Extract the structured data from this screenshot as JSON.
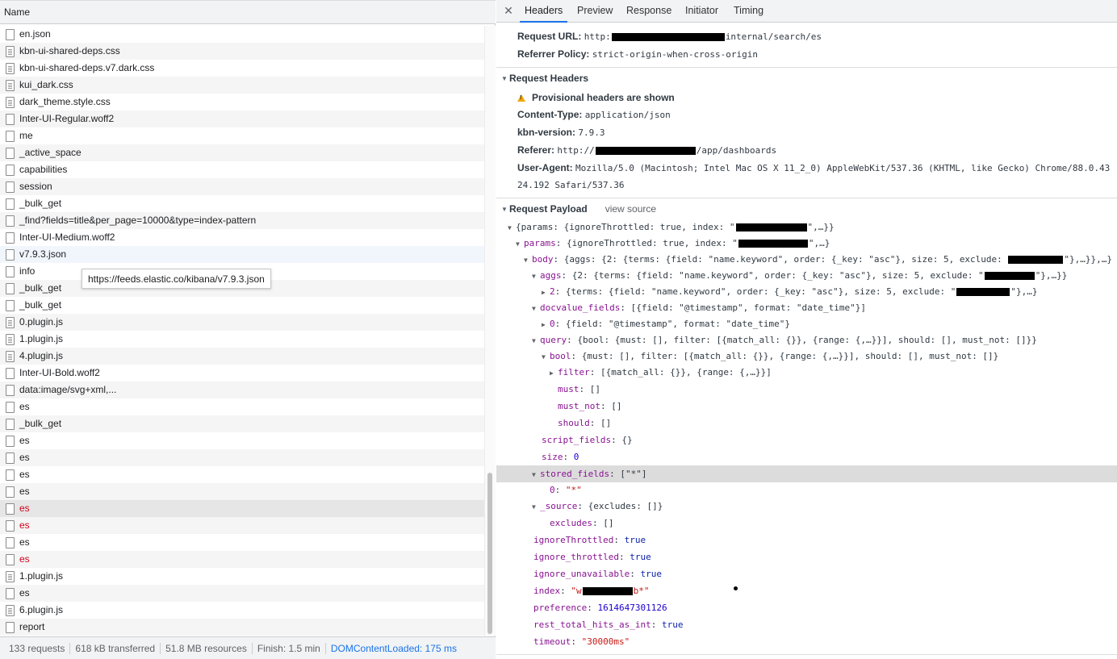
{
  "list": {
    "header": "Name",
    "rows": [
      {
        "name": "en.json",
        "icon": "document-icon",
        "error": false
      },
      {
        "name": "kbn-ui-shared-deps.css",
        "icon": "stylesheet-icon",
        "error": false
      },
      {
        "name": "kbn-ui-shared-deps.v7.dark.css",
        "icon": "stylesheet-icon",
        "error": false
      },
      {
        "name": "kui_dark.css",
        "icon": "stylesheet-icon",
        "error": false
      },
      {
        "name": "dark_theme.style.css",
        "icon": "stylesheet-icon",
        "error": false
      },
      {
        "name": "Inter-UI-Regular.woff2",
        "icon": "document-icon",
        "error": false
      },
      {
        "name": "me",
        "icon": "document-icon",
        "error": false
      },
      {
        "name": "_active_space",
        "icon": "document-icon",
        "error": false
      },
      {
        "name": "capabilities",
        "icon": "document-icon",
        "error": false
      },
      {
        "name": "session",
        "icon": "document-icon",
        "error": false
      },
      {
        "name": "_bulk_get",
        "icon": "document-icon",
        "error": false
      },
      {
        "name": "_find?fields=title&per_page=10000&type=index-pattern",
        "icon": "document-icon",
        "error": false
      },
      {
        "name": "Inter-UI-Medium.woff2",
        "icon": "document-icon",
        "error": false
      },
      {
        "name": "v7.9.3.json",
        "icon": "document-icon",
        "error": false,
        "hover": true
      },
      {
        "name": "info",
        "icon": "document-icon",
        "error": false
      },
      {
        "name": "_bulk_get",
        "icon": "document-icon",
        "error": false
      },
      {
        "name": "_bulk_get",
        "icon": "document-icon",
        "error": false
      },
      {
        "name": "0.plugin.js",
        "icon": "script-icon",
        "error": false
      },
      {
        "name": "1.plugin.js",
        "icon": "script-icon",
        "error": false
      },
      {
        "name": "4.plugin.js",
        "icon": "script-icon",
        "error": false
      },
      {
        "name": "Inter-UI-Bold.woff2",
        "icon": "document-icon",
        "error": false
      },
      {
        "name": "data:image/svg+xml,...",
        "icon": "document-icon",
        "error": false
      },
      {
        "name": "es",
        "icon": "document-icon",
        "error": false
      },
      {
        "name": "_bulk_get",
        "icon": "document-icon",
        "error": false
      },
      {
        "name": "es",
        "icon": "document-icon",
        "error": false
      },
      {
        "name": "es",
        "icon": "document-icon",
        "error": false
      },
      {
        "name": "es",
        "icon": "document-icon",
        "error": false
      },
      {
        "name": "es",
        "icon": "document-icon",
        "error": false
      },
      {
        "name": "es",
        "icon": "document-icon",
        "error": true,
        "selected": true
      },
      {
        "name": "es",
        "icon": "document-icon",
        "error": true
      },
      {
        "name": "es",
        "icon": "document-icon",
        "error": false
      },
      {
        "name": "es",
        "icon": "document-icon",
        "error": true
      },
      {
        "name": "1.plugin.js",
        "icon": "script-icon",
        "error": false
      },
      {
        "name": "es",
        "icon": "document-icon",
        "error": false
      },
      {
        "name": "6.plugin.js",
        "icon": "script-icon",
        "error": false
      },
      {
        "name": "report",
        "icon": "document-icon",
        "error": false
      }
    ],
    "tooltip": "https://feeds.elastic.co/kibana/v7.9.3.json"
  },
  "status": {
    "requests": "133 requests",
    "transferred": "618 kB transferred",
    "resources": "51.8 MB resources",
    "finish": "Finish: 1.5 min",
    "dom_loaded": "DOMContentLoaded: 175 ms"
  },
  "tabs": [
    "Headers",
    "Preview",
    "Response",
    "Initiator",
    "Timing"
  ],
  "general": {
    "url_key": "Request URL:",
    "url_prefix": "http:",
    "url_suffix": "internal/search/es",
    "policy_key": "Referrer Policy:",
    "policy_value": "strict-origin-when-cross-origin"
  },
  "request_headers": {
    "title": "Request Headers",
    "warning": "Provisional headers are shown",
    "content_type_key": "Content-Type:",
    "content_type_value": "application/json",
    "kbn_key": "kbn-version:",
    "kbn_value": "7.9.3",
    "referer_key": "Referer:",
    "referer_prefix": "http://",
    "referer_suffix": "/app/dashboards",
    "ua_key": "User-Agent:",
    "ua_value_1": "Mozilla/5.0 (Macintosh; Intel Mac OS X 11_2_0) AppleWebKit/537.36 (KHTML, like Gecko) Chrome/88.0.43",
    "ua_value_2": "24.192 Safari/537.36"
  },
  "payload": {
    "title": "Request Payload",
    "view_source": "view source",
    "l1_a": "{params: {ignoreThrottled: true, index: \"",
    "l1_b": "\",…}}",
    "l2_key": "params",
    "l2_a": ": {ignoreThrottled: true, index: \"",
    "l2_b": "\",…}",
    "l3_key": "body",
    "l3_a": ": {aggs: {2: {terms: {field: \"name.keyword\", order: {_key: \"asc\"}, size: 5, exclude: ",
    "l3_b": "\"},…}},…}",
    "l4_key": "aggs",
    "l4_a": ": {2: {terms: {field: \"name.keyword\", order: {_key: \"asc\"}, size: 5, exclude: \"",
    "l4_b": "\"},…}}",
    "l5_key": "2",
    "l5_a": ": {terms: {field: \"name.keyword\", order: {_key: \"asc\"}, size: 5, exclude: \"",
    "l5_b": "\"},…}",
    "l6_key": "docvalue_fields",
    "l6_val": ": [{field: \"@timestamp\", format: \"date_time\"}]",
    "l7_key": "0",
    "l7_val": ": {field: \"@timestamp\", format: \"date_time\"}",
    "l8_key": "query",
    "l8_val": ": {bool: {must: [], filter: [{match_all: {}}, {range: {,…}}], should: [], must_not: []}}",
    "l9_key": "bool",
    "l9_val": ": {must: [], filter: [{match_all: {}}, {range: {,…}}], should: [], must_not: []}",
    "l10_key": "filter",
    "l10_val": ": [{match_all: {}}, {range: {,…}}]",
    "l11_key": "must",
    "l11_val": ": []",
    "l12_key": "must_not",
    "l12_val": ": []",
    "l13_key": "should",
    "l13_val": ": []",
    "l14_key": "script_fields",
    "l14_val": ": {}",
    "l15_key": "size",
    "l15_val": "0",
    "l16_key": "stored_fields",
    "l16_val": ": [\"*\"]",
    "l17_key": "0",
    "l17_val": "\"*\"",
    "l18_key": "_source",
    "l18_val": ": {excludes: []}",
    "l19_key": "excludes",
    "l19_val": ": []",
    "l20_key": "ignoreThrottled",
    "l20_val": "true",
    "l21_key": "ignore_throttled",
    "l21_val": "true",
    "l22_key": "ignore_unavailable",
    "l22_val": "true",
    "l23_key": "index",
    "l23_a": "\"w",
    "l23_b": "b*\"",
    "l24_key": "preference",
    "l24_val": "1614647301126",
    "l25_key": "rest_total_hits_as_int",
    "l25_val": "true",
    "l26_key": "timeout",
    "l26_val": "\"30000ms\""
  },
  "colors": {
    "tab_underline": "#1a73e8",
    "error_text": "#d0021b",
    "key_purple": "#881391",
    "string_red": "#c41a16",
    "number_blue": "#1c00cf"
  }
}
